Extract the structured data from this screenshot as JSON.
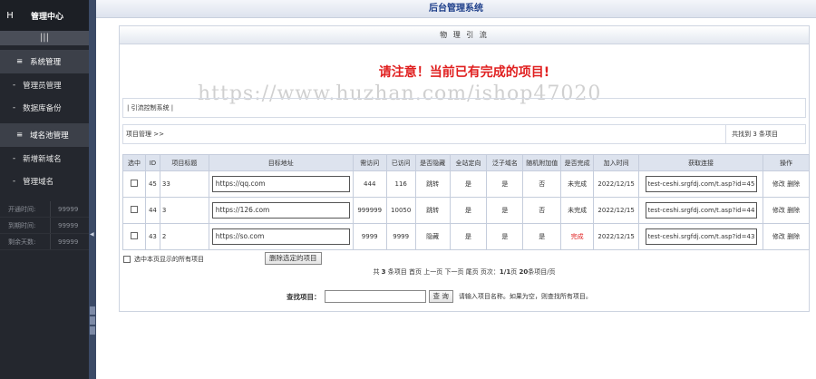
{
  "sidebar": {
    "logo_letter": "H",
    "title": "管理中心",
    "toggle_icon": "|||",
    "sections": [
      {
        "label": "系统管理",
        "items": [
          "管理员管理",
          "数据库备份"
        ]
      },
      {
        "label": "域名池管理",
        "items": [
          "新增新域名",
          "管理域名"
        ]
      }
    ],
    "stats": [
      {
        "key": "开通时间:",
        "value": "99999"
      },
      {
        "key": "到期时间:",
        "value": "99999"
      },
      {
        "key": "剩余天数:",
        "value": "99999"
      }
    ]
  },
  "topbar": {
    "title": "后台管理系统"
  },
  "panel": {
    "title": "物 理 引 流",
    "notice": "请注意！当前已有完成的项目!",
    "watermark": "https://www.huzhan.com/ishop47020",
    "ctrl_label": "| 引流控制系统 |",
    "mgmt_label": "项目管理 >>",
    "found": "共找到 3 条项目"
  },
  "table": {
    "headers": [
      "选中",
      "ID",
      "项目标题",
      "目标地址",
      "需访问",
      "已访问",
      "是否隐藏",
      "全站定向",
      "泛子域名",
      "随机附加值",
      "是否完成",
      "加入时间",
      "获取连接",
      "操作"
    ],
    "rows": [
      {
        "id": "45",
        "title": "33",
        "url": "https://qq.com",
        "need": "444",
        "done": "116",
        "hidden": "跳转",
        "site": "是",
        "sub": "是",
        "rand": "否",
        "status": "未完成",
        "time": "2022/12/15",
        "link": "test-ceshi.srgfdj.com/t.asp?id=45",
        "edit": "修改",
        "del": "删除"
      },
      {
        "id": "44",
        "title": "3",
        "url": "https://126.com",
        "need": "999999",
        "done": "10050",
        "hidden": "跳转",
        "site": "是",
        "sub": "是",
        "rand": "否",
        "status": "未完成",
        "time": "2022/12/15",
        "link": "test-ceshi.srgfdj.com/t.asp?id=44",
        "edit": "修改",
        "del": "删除"
      },
      {
        "id": "43",
        "title": "2",
        "url": "https://so.com",
        "need": "9999",
        "done": "9999",
        "hidden": "隐藏",
        "site": "是",
        "sub": "是",
        "rand": "是",
        "status": "完成",
        "time": "2022/12/15",
        "link": "test-ceshi.srgfdj.com/t.asp?id=43",
        "edit": "修改",
        "del": "删除"
      }
    ]
  },
  "footer": {
    "select_all": "选中本页显示的所有项目",
    "delete_btn": "删除选定的项目",
    "pager": {
      "pre": "共 ",
      "total": "3",
      "mid": " 条项目  首页 上一页 下一页 尾页 页次：",
      "page": "1/1",
      "post": "页  ",
      "per": "20",
      "per_post": "条项目/页"
    },
    "search_label": "查找项目：",
    "search_value": "",
    "search_btn": "查 询",
    "search_hint": "请输入项目名称。如果为空，则查找所有项目。"
  },
  "colors": {
    "accent": "#1e3f8a",
    "alert": "#e02020",
    "sidebar": "#24272e"
  }
}
